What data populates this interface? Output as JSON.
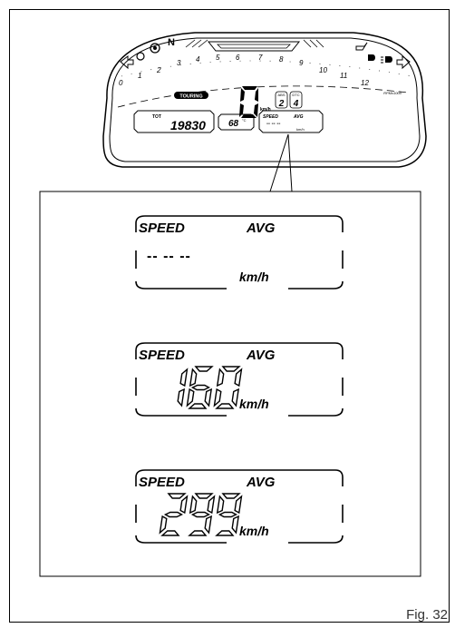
{
  "figure": {
    "label": "Fig. 32"
  },
  "cluster": {
    "scale_numbers": [
      "0",
      "1",
      "2",
      "3",
      "4",
      "5",
      "6",
      "7",
      "8",
      "9",
      "10",
      "11",
      "12"
    ],
    "mode": "TOURING",
    "speed_value": "0",
    "speed_unit": "km/h",
    "abs_label": "ABS",
    "abs_value": "2",
    "dtc_label": "DTC",
    "dtc_value": "4",
    "rpm_label": "RPMx1000",
    "odometer_label": "TOT",
    "odometer_value": "19830",
    "temp_value": "68",
    "temp_unit": "°C",
    "mini_speed_label": "SPEED",
    "mini_avg_label": "AVG",
    "mini_value": "-- -- --",
    "mini_unit": "km/h",
    "neutral_label": "N"
  },
  "panels": [
    {
      "speed_label": "SPEED",
      "avg_label": "AVG",
      "value": "-- -- --",
      "unit": "km/h"
    },
    {
      "speed_label": "SPEED",
      "avg_label": "AVG",
      "value": "160",
      "unit": "km/h"
    },
    {
      "speed_label": "SPEED",
      "avg_label": "AVG",
      "value": "299",
      "unit": "km/h"
    }
  ]
}
